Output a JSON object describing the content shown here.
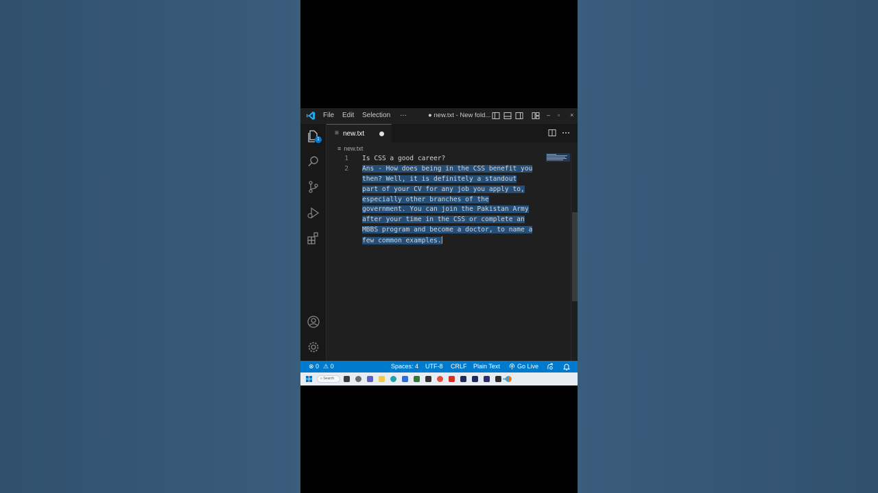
{
  "titlebar": {
    "menu": [
      "File",
      "Edit",
      "Selection",
      "···"
    ],
    "title": "● new.txt - New fold...",
    "window_controls": [
      "–",
      "▫",
      "×"
    ]
  },
  "activitybar": {
    "icons": [
      "explorer-icon",
      "search-icon",
      "source-control-icon",
      "run-debug-icon",
      "extensions-icon",
      "account-icon",
      "settings-icon"
    ],
    "explorer_badge": "1"
  },
  "tab": {
    "label": "new.txt",
    "icon": "≡"
  },
  "breadcrumb": "new.txt",
  "editor": {
    "lines": [
      {
        "num": "1",
        "text": "Is CSS a good career?"
      },
      {
        "num": "2",
        "text": "Ans - How does being in the CSS benefit you"
      },
      {
        "num": "",
        "text": "then? Well, it is definitely a standout"
      },
      {
        "num": "",
        "text": "part of your CV for any job you apply to,"
      },
      {
        "num": "",
        "text": "especially other branches of the"
      },
      {
        "num": "",
        "text": "government. You can join the Pakistan Army"
      },
      {
        "num": "",
        "text": "after your time in the CSS or complete an"
      },
      {
        "num": "",
        "text": "MBBS program and become a doctor, to name a"
      },
      {
        "num": "",
        "text": "few common examples."
      }
    ]
  },
  "statusbar": {
    "errors": "⊗ 0",
    "warnings": "⚠ 0",
    "spaces": "Spaces: 4",
    "encoding": "UTF-8",
    "eol": "CRLF",
    "language": "Plain Text",
    "golive": "Go Live"
  },
  "taskbar": {
    "search": "Search"
  },
  "colors": {
    "accent": "#007acc",
    "selection": "#264f78",
    "editor_bg": "#1f1f1f"
  }
}
